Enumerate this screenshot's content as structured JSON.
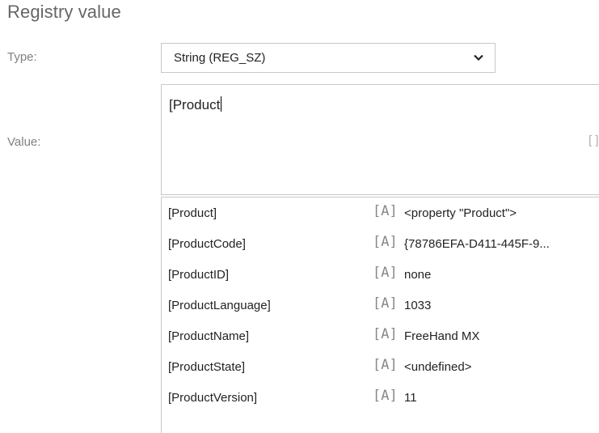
{
  "section": {
    "title": "Registry value"
  },
  "type_field": {
    "label": "Type:",
    "selected": "String (REG_SZ)"
  },
  "value_field": {
    "label": "Value:",
    "text": "[Product",
    "browse_label": "[ ]"
  },
  "suggestions": [
    {
      "name": "[Product]",
      "tag": "[A]",
      "value": "<property \"Product\">"
    },
    {
      "name": "[ProductCode]",
      "tag": "[A]",
      "value": "{78786EFA-D411-445F-9..."
    },
    {
      "name": "[ProductID]",
      "tag": "[A]",
      "value": "none"
    },
    {
      "name": "[ProductLanguage]",
      "tag": "[A]",
      "value": "1033"
    },
    {
      "name": "[ProductName]",
      "tag": "[A]",
      "value": "FreeHand MX"
    },
    {
      "name": "[ProductState]",
      "tag": "[A]",
      "value": "<undefined>"
    },
    {
      "name": "[ProductVersion]",
      "tag": "[A]",
      "value": "11"
    }
  ],
  "icons": {
    "dropdown_chevron": "chevron-down-icon"
  }
}
